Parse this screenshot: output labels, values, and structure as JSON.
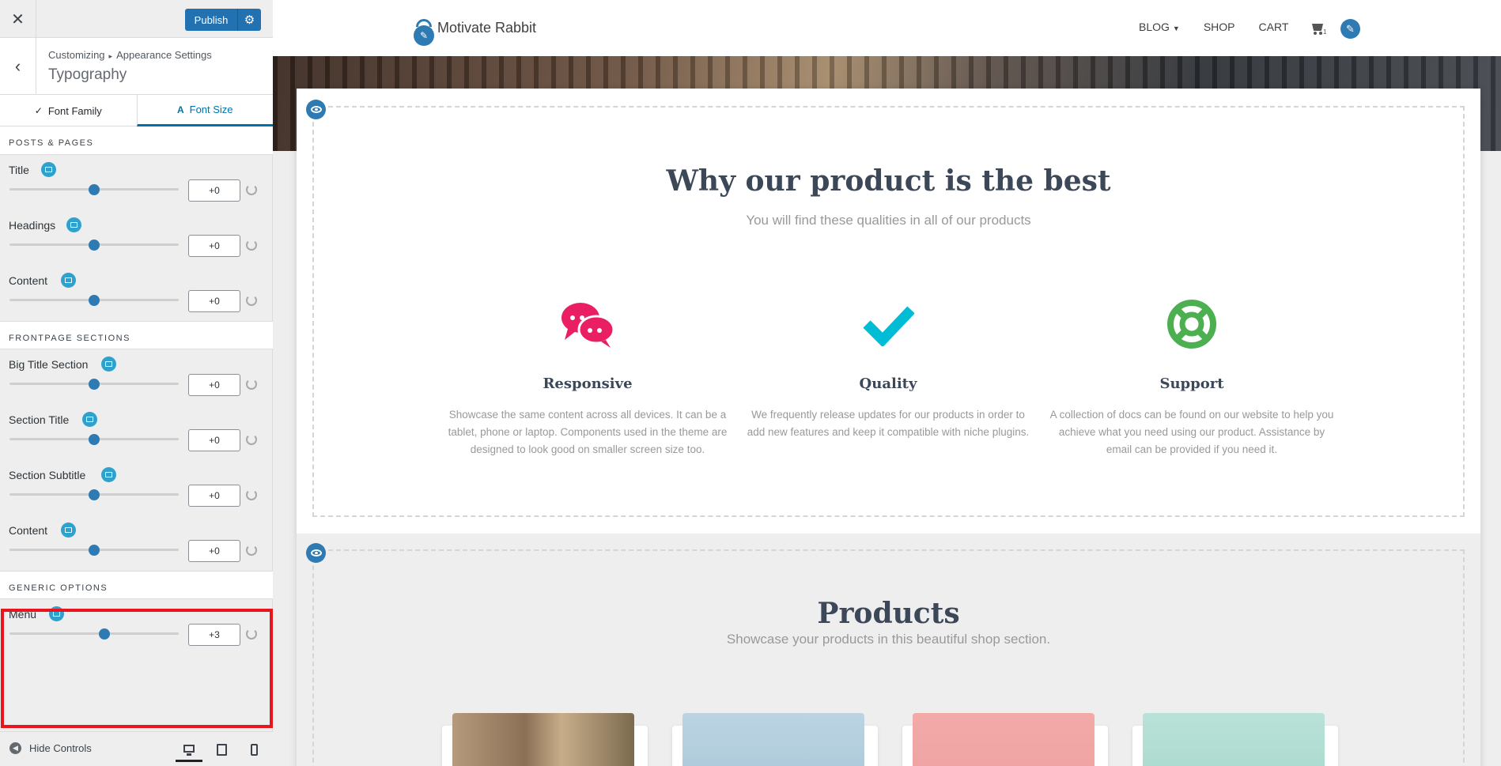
{
  "customizer": {
    "close_icon": "close-icon",
    "publish_label": "Publish",
    "breadcrumb": [
      "Customizing",
      "Appearance Settings"
    ],
    "breadcrumb_sep": "▸",
    "section_title": "Typography",
    "tabs": [
      {
        "label": "Font Family",
        "icon": "abc-check-icon",
        "active": false
      },
      {
        "label": "Font Size",
        "icon": "font-icon",
        "active": true
      }
    ],
    "groups": {
      "posts_pages": {
        "title": "Posts & Pages",
        "controls": [
          {
            "label": "Title",
            "value": "+0",
            "level": 0.5
          },
          {
            "label": "Headings",
            "value": "+0",
            "level": 0.5
          },
          {
            "label": "Content",
            "value": "+0",
            "level": 0.5
          }
        ]
      },
      "frontpage": {
        "title": "Frontpage Sections",
        "controls": [
          {
            "label": "Big Title Section",
            "value": "+0",
            "level": 0.5
          },
          {
            "label": "Section Title",
            "value": "+0",
            "level": 0.5
          },
          {
            "label": "Section Subtitle",
            "value": "+0",
            "level": 0.5
          },
          {
            "label": "Content",
            "value": "+0",
            "level": 0.5
          }
        ]
      },
      "generic": {
        "title": "Generic Options",
        "controls": [
          {
            "label": "Menu",
            "value": "+3",
            "level": 0.56
          }
        ]
      }
    },
    "hide_controls_label": "Hide Controls",
    "devices": [
      "desktop-icon",
      "tablet-icon",
      "mobile-icon"
    ],
    "highlight_color": "#e8141e",
    "accent_color": "#0073aa"
  },
  "preview": {
    "site_title": "Motivate Rabbit",
    "menu": {
      "blog": "BLOG",
      "shop": "SHOP",
      "cart": "CART",
      "cart_count": "1"
    },
    "features": {
      "title": "Why our product is the best",
      "subtitle": "You will find these qualities in all of our products",
      "items": [
        {
          "title": "Responsive",
          "text": "Showcase the same content across all devices. It can be a tablet, phone or laptop. Components used in the theme are designed to look good on smaller screen size too.",
          "color": "#e91e63",
          "icon": "chat-bubbles-icon"
        },
        {
          "title": "Quality",
          "text": "We frequently release updates for our products in order to add new features and keep it compatible with niche plugins.",
          "color": "#00bcd4",
          "icon": "checkmark-icon"
        },
        {
          "title": "Support",
          "text": "A collection of docs can be found on our website to help you achieve what you need using our product. Assistance by email can be provided if you need it.",
          "color": "#4caf50",
          "icon": "life-ring-icon"
        }
      ]
    },
    "products": {
      "title": "Products",
      "subtitle": "Showcase your products in this beautiful shop section."
    }
  }
}
